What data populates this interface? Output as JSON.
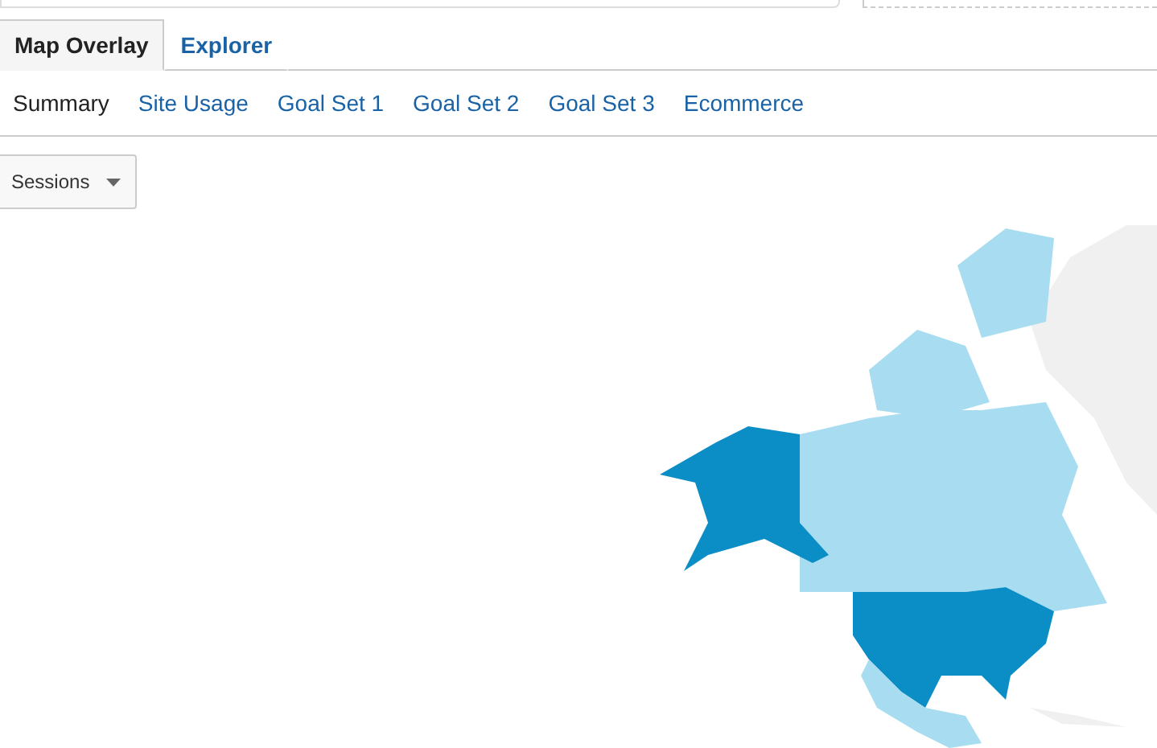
{
  "tabs": [
    {
      "label": "Map Overlay",
      "selected": true
    },
    {
      "label": "Explorer",
      "selected": false
    }
  ],
  "subtabs": [
    {
      "label": "Summary",
      "selected": true
    },
    {
      "label": "Site Usage",
      "selected": false
    },
    {
      "label": "Goal Set 1",
      "selected": false
    },
    {
      "label": "Goal Set 2",
      "selected": false
    },
    {
      "label": "Goal Set 3",
      "selected": false
    },
    {
      "label": "Ecommerce",
      "selected": false
    }
  ],
  "metric_dropdown": {
    "value": "Sessions"
  }
}
